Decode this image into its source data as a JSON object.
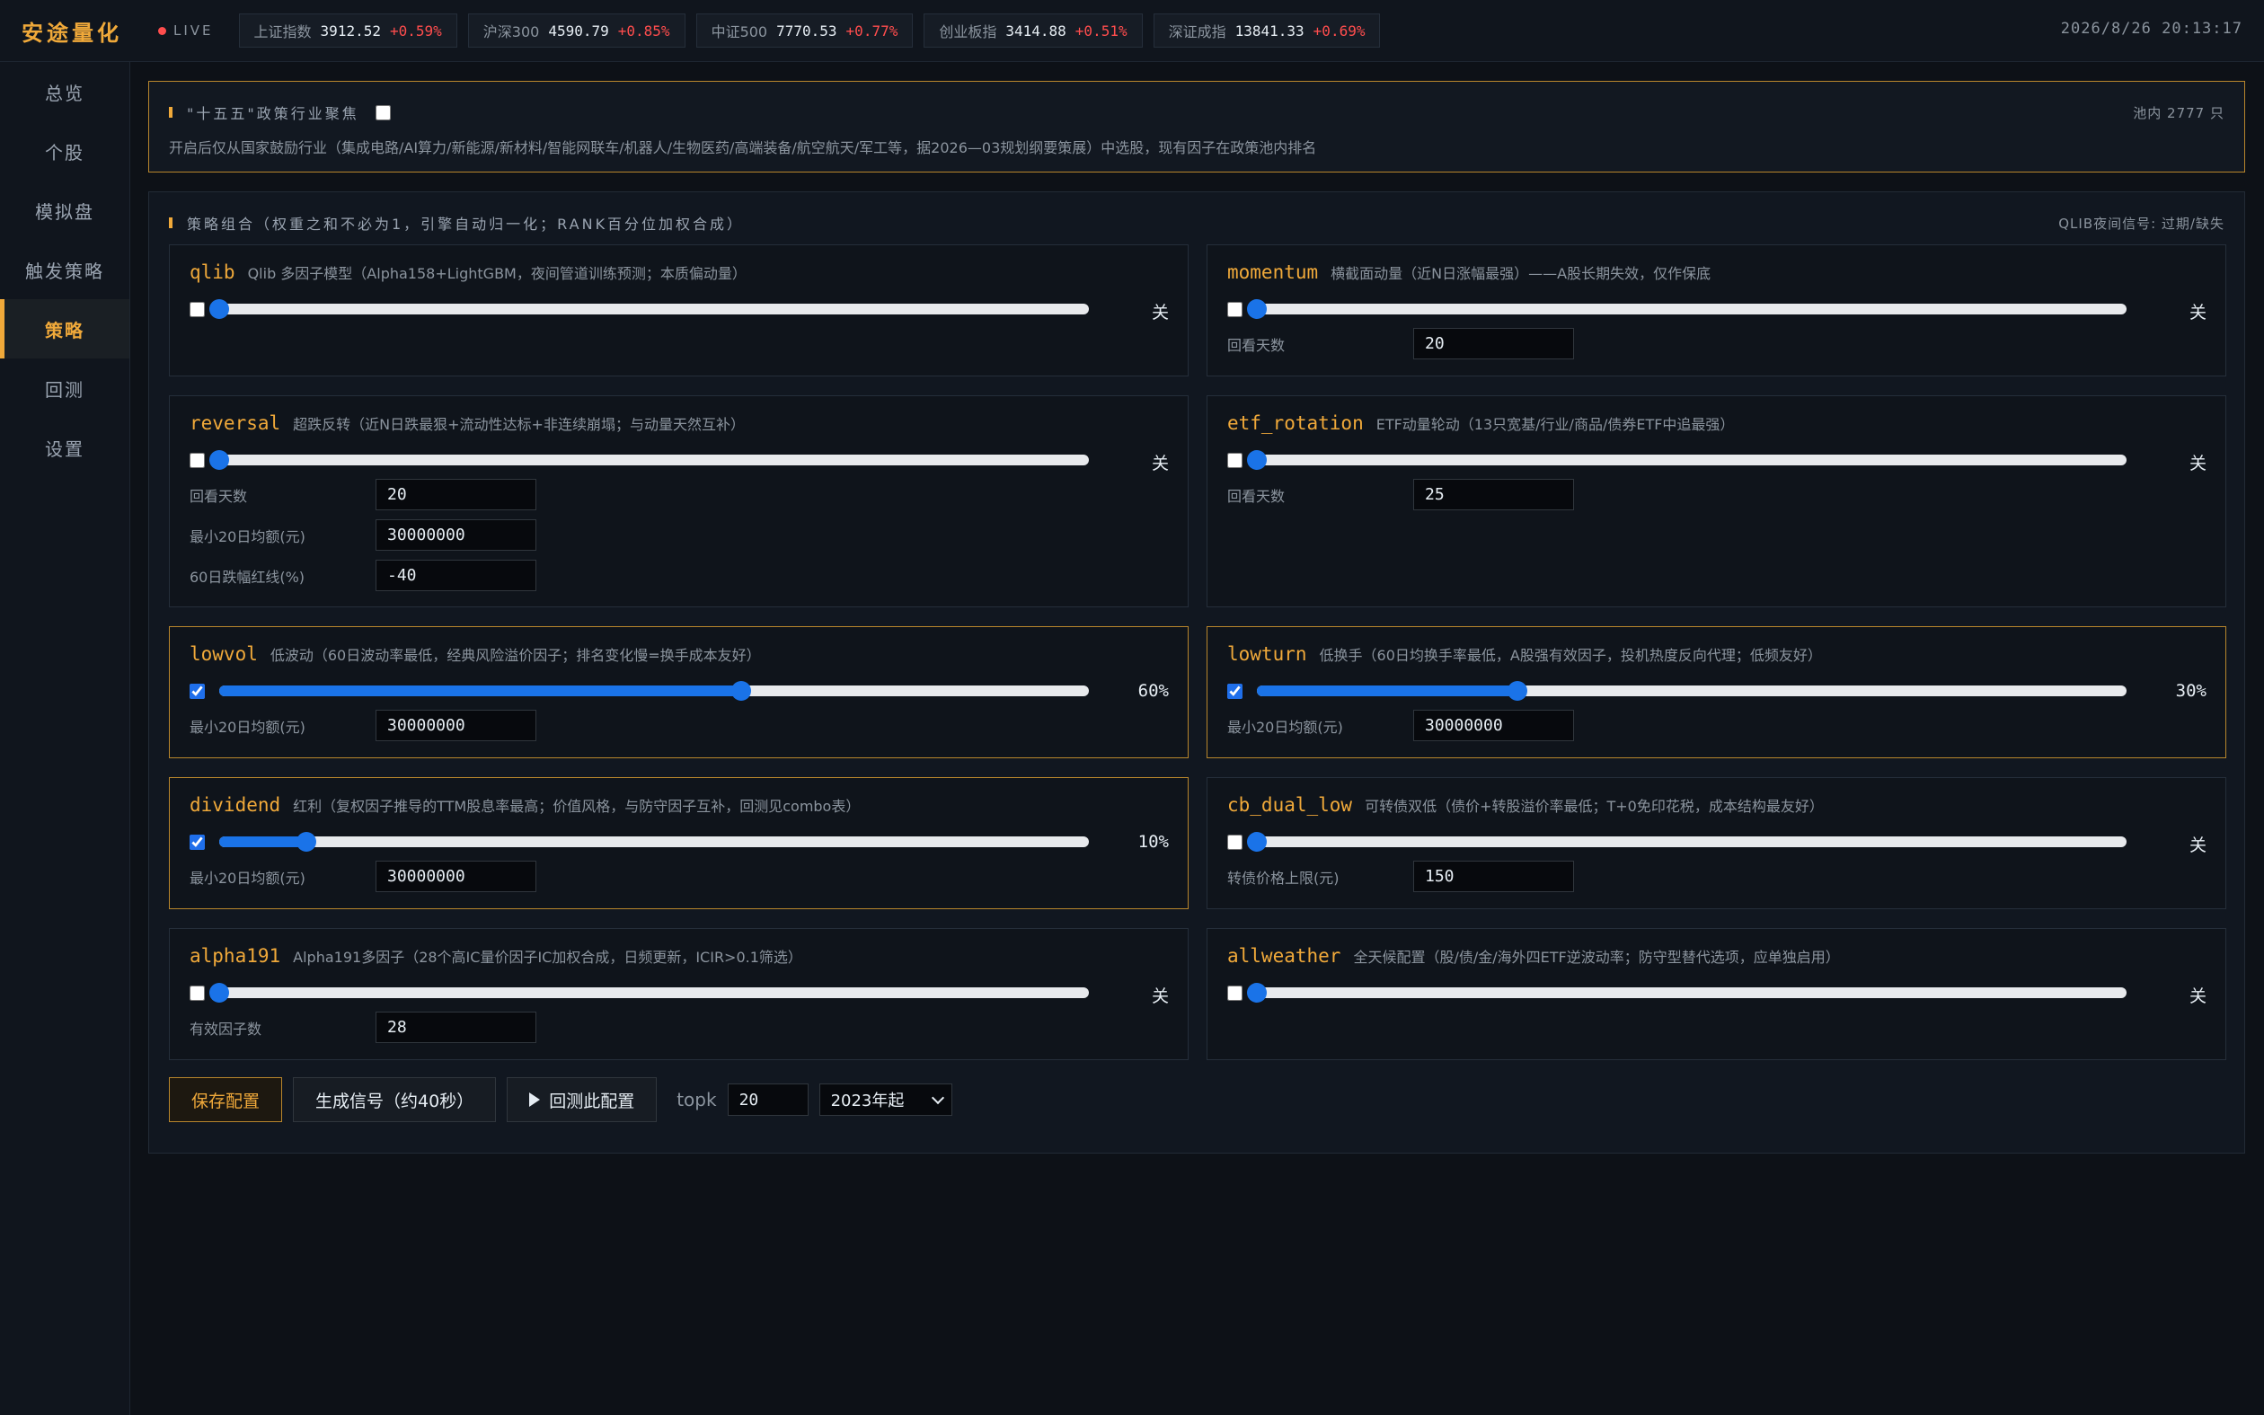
{
  "header": {
    "brand": "安途量化",
    "live": "LIVE",
    "tickers": [
      {
        "name": "上证指数",
        "value": "3912.52",
        "change": "+0.59%"
      },
      {
        "name": "沪深300",
        "value": "4590.79",
        "change": "+0.85%"
      },
      {
        "name": "中证500",
        "value": "7770.53",
        "change": "+0.77%"
      },
      {
        "name": "创业板指",
        "value": "3414.88",
        "change": "+0.51%"
      },
      {
        "name": "深证成指",
        "value": "13841.33",
        "change": "+0.69%"
      }
    ],
    "datetime": "2026/8/26 20:13:17"
  },
  "sidebar": {
    "items": [
      {
        "label": "总览"
      },
      {
        "label": "个股"
      },
      {
        "label": "模拟盘"
      },
      {
        "label": "触发策略"
      },
      {
        "label": "策略",
        "active": true
      },
      {
        "label": "回测"
      },
      {
        "label": "设置"
      }
    ]
  },
  "policy": {
    "title": "\"十五五\"政策行业聚焦",
    "checked": false,
    "pool_count": "池内 2777 只",
    "description": "开启后仅从国家鼓励行业（集成电路/AI算力/新能源/新材料/智能网联车/机器人/生物医药/高端装备/航空航天/军工等，据2026—03规划纲要策展）中选股，现有因子在政策池内排名"
  },
  "strategies": {
    "title": "策略组合（权重之和不必为1，引擎自动归一化；RANK百分位加权合成）",
    "qlib_signal": "QLIB夜间信号: 过期/缺失",
    "cards": [
      {
        "name": "qlib",
        "desc": "Qlib 多因子模型（Alpha158+LightGBM，夜间管道训练预测；本质偏动量）",
        "enabled": false,
        "weight": 0,
        "weight_label": "关",
        "params": []
      },
      {
        "name": "momentum",
        "desc": "横截面动量（近N日涨幅最强）——A股长期失效，仅作保底",
        "enabled": false,
        "weight": 0,
        "weight_label": "关",
        "params": [
          {
            "label": "回看天数",
            "value": "20"
          }
        ]
      },
      {
        "name": "reversal",
        "desc": "超跌反转（近N日跌最狠+流动性达标+非连续崩塌；与动量天然互补）",
        "enabled": false,
        "weight": 0,
        "weight_label": "关",
        "params": [
          {
            "label": "回看天数",
            "value": "20"
          },
          {
            "label": "最小20日均额(元)",
            "value": "30000000"
          },
          {
            "label": "60日跌幅红线(%)",
            "value": "-40"
          }
        ]
      },
      {
        "name": "etf_rotation",
        "desc": "ETF动量轮动（13只宽基/行业/商品/债券ETF中追最强）",
        "enabled": false,
        "weight": 0,
        "weight_label": "关",
        "params": [
          {
            "label": "回看天数",
            "value": "25"
          }
        ]
      },
      {
        "name": "lowvol",
        "desc": "低波动（60日波动率最低，经典风险溢价因子；排名变化慢=换手成本友好）",
        "enabled": true,
        "weight": 0.6,
        "weight_label": "60%",
        "params": [
          {
            "label": "最小20日均额(元)",
            "value": "30000000"
          }
        ]
      },
      {
        "name": "lowturn",
        "desc": "低换手（60日均换手率最低，A股强有效因子，投机热度反向代理；低频友好）",
        "enabled": true,
        "weight": 0.3,
        "weight_label": "30%",
        "params": [
          {
            "label": "最小20日均额(元)",
            "value": "30000000"
          }
        ]
      },
      {
        "name": "dividend",
        "desc": "红利（复权因子推导的TTM股息率最高；价值风格，与防守因子互补，回测见combo表）",
        "enabled": true,
        "weight": 0.1,
        "weight_label": "10%",
        "params": [
          {
            "label": "最小20日均额(元)",
            "value": "30000000"
          }
        ]
      },
      {
        "name": "cb_dual_low",
        "desc": "可转债双低（债价+转股溢价率最低；T+0免印花税，成本结构最友好）",
        "enabled": false,
        "weight": 0,
        "weight_label": "关",
        "params": [
          {
            "label": "转债价格上限(元)",
            "value": "150"
          }
        ]
      },
      {
        "name": "alpha191",
        "desc": "Alpha191多因子（28个高IC量价因子IC加权合成，日频更新，ICIR>0.1筛选）",
        "enabled": false,
        "weight": 0,
        "weight_label": "关",
        "params": [
          {
            "label": "有效因子数",
            "value": "28"
          }
        ]
      },
      {
        "name": "allweather",
        "desc": "全天候配置（股/债/金/海外四ETF逆波动率；防守型替代选项，应单独启用）",
        "enabled": false,
        "weight": 0,
        "weight_label": "关",
        "params": []
      }
    ]
  },
  "actions": {
    "save_label": "保存配置",
    "generate_label": "生成信号（约40秒）",
    "backtest_label": "回测此配置",
    "topk_label": "topk",
    "topk_value": "20",
    "year_selected": "2023年起"
  },
  "colors": {
    "accent": "#f0a93a",
    "up": "#ff4d4d",
    "slider_blue": "#1a73e8"
  }
}
